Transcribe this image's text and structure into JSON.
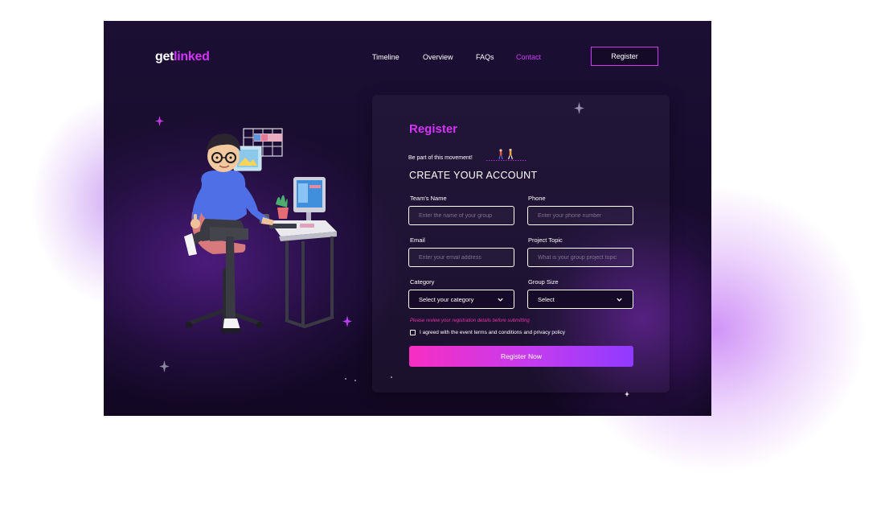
{
  "brand": {
    "logo_part1": "get",
    "logo_part2": "linked",
    "accent_color": "#d434fe"
  },
  "nav": {
    "items": [
      "Timeline",
      "Overview",
      "FAQs",
      "Contact"
    ],
    "active": "Contact",
    "register_label": "Register"
  },
  "form": {
    "title": "Register",
    "subtitle": "Be part of this movement!",
    "heading": "CREATE YOUR ACCOUNT",
    "fields": {
      "team_name": {
        "label": "Team's Name",
        "placeholder": "Enter the name of your group"
      },
      "phone": {
        "label": "Phone",
        "placeholder": "Enter your phone number"
      },
      "email": {
        "label": "Email",
        "placeholder": "Enter your email address"
      },
      "project_topic": {
        "label": "Project Topic",
        "placeholder": "What is your group project topic"
      },
      "category": {
        "label": "Category",
        "value": "Select your category"
      },
      "group_size": {
        "label": "Group Size",
        "value": "Select"
      }
    },
    "warning": "Please review your registration details before submitting",
    "agree_text": "I agreed with the event terms and conditions  and privacy policy",
    "submit_label": "Register Now",
    "submit_gradient": [
      "#f72ec2",
      "#903aff"
    ]
  },
  "icons": [
    "sparkle-star-icon",
    "chevron-down-icon",
    "checkbox-icon",
    "walking-people-icon"
  ]
}
